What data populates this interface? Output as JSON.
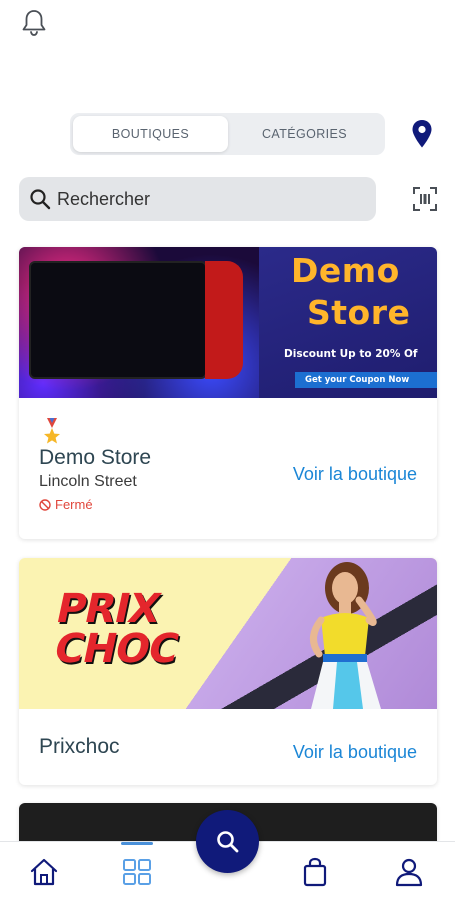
{
  "tabs": [
    {
      "label": "BOUTIQUES",
      "active": true
    },
    {
      "label": "CATÉGORIES",
      "active": false
    }
  ],
  "search": {
    "placeholder": "Rechercher"
  },
  "stores": [
    {
      "name": "Demo Store",
      "street": "Lincoln Street",
      "status": "Fermé",
      "action": "Voir la boutique",
      "banner": {
        "line1": "Demo",
        "line2": "Store",
        "discount": "Discount Up to 20% Of",
        "coupon": "Get your Coupon Now"
      }
    },
    {
      "name": "Prixchoc",
      "action": "Voir la boutique",
      "banner": {
        "logo_line1": "PRIX",
        "logo_line2": "CHOC"
      }
    }
  ],
  "nav": {
    "items": [
      "home-icon",
      "grid-icon",
      "search-icon",
      "bag-icon",
      "user-icon"
    ],
    "active": "grid-icon"
  },
  "colors": {
    "accent": "#101a7a",
    "link": "#1b86d6",
    "closed": "#e0473c",
    "title": "#2e4652"
  }
}
